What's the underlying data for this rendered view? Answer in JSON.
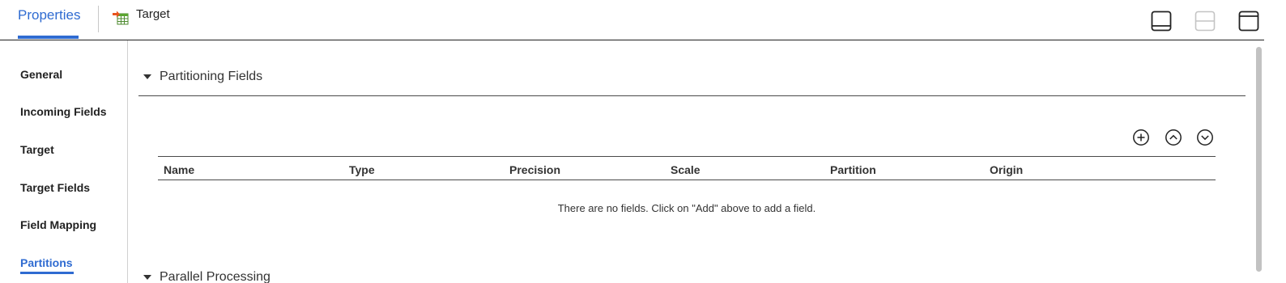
{
  "header": {
    "tab_label": "Properties",
    "object_title": "Target",
    "object_icon": "target-table-icon",
    "layout_buttons": [
      {
        "name": "dock-bottom-icon",
        "enabled": true
      },
      {
        "name": "split-horizontal-icon",
        "enabled": false
      },
      {
        "name": "maximize-panel-icon",
        "enabled": true
      }
    ]
  },
  "sidebar": {
    "items": [
      {
        "label": "General"
      },
      {
        "label": "Incoming Fields"
      },
      {
        "label": "Target"
      },
      {
        "label": "Target Fields"
      },
      {
        "label": "Field Mapping"
      },
      {
        "label": "Partitions",
        "active": true
      }
    ]
  },
  "main": {
    "sections": [
      {
        "title": "Partitioning Fields",
        "expanded": true
      },
      {
        "title": "Parallel Processing",
        "expanded": true
      }
    ],
    "toolbar": {
      "add_icon": "add-circle-icon",
      "move_up_icon": "move-up-icon",
      "move_down_icon": "move-down-icon"
    },
    "table": {
      "columns": [
        "Name",
        "Type",
        "Precision",
        "Scale",
        "Partition",
        "Origin"
      ],
      "rows": [],
      "empty_message": "There are no fields. Click on \"Add\" above to add a field."
    }
  },
  "colors": {
    "accent": "#2f6bd1",
    "text": "#222222",
    "rule": "#4a4a4a"
  }
}
